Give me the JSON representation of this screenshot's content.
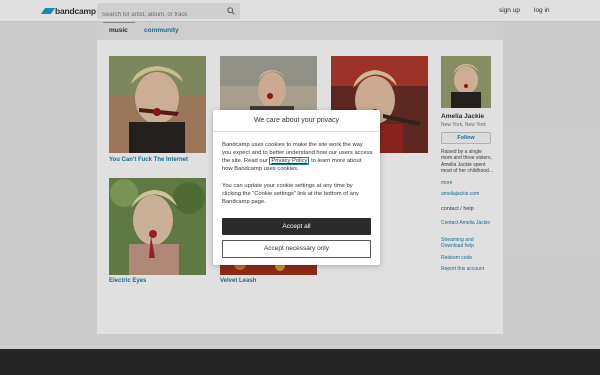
{
  "header": {
    "logo_text": "bandcamp",
    "search_placeholder": "Search for artist, album, or track",
    "signup_label": "sign up",
    "login_label": "log in"
  },
  "tabs": [
    {
      "label": "music"
    },
    {
      "label": "community"
    }
  ],
  "albums": [
    {
      "title": "You Can't Fuck The Internet"
    },
    {
      "title": ""
    },
    {
      "title": ""
    },
    {
      "title": "Electric Eyes"
    },
    {
      "title": "Velvet Leash"
    }
  ],
  "artist": {
    "name": "Amelia Jackie",
    "location": "New York, New York",
    "follow_label": "Follow",
    "bio": "Raised by a single mom and three sisters, Amelia Jackie spent most of her childhood...",
    "more_label": "more",
    "website": "ameliajackie.com",
    "contact_heading": "contact / help",
    "links": [
      "Contact Amelia Jackie",
      "Streaming and Download help",
      "Redeem code",
      "Report this account"
    ]
  },
  "cookie_modal": {
    "title": "We care about your privacy",
    "p1_before": "Bandcamp uses cookies to make the site work the way you expect and to better understand how our users access the site. Read our ",
    "p1_link": "Privacy Policy",
    "p1_after": " to learn more about how Bandcamp uses cookies.",
    "p2": "You can update your cookie settings at any time by clicking the “Cookie settings” link at the bottom of any Bandcamp page.",
    "accept_all_label": "Accept all",
    "accept_necessary_label": "Accept necessary only"
  },
  "colors": {
    "brand": "#1da0c3",
    "link": "#1a7ca8",
    "accept_button": "#2b2b2b"
  }
}
